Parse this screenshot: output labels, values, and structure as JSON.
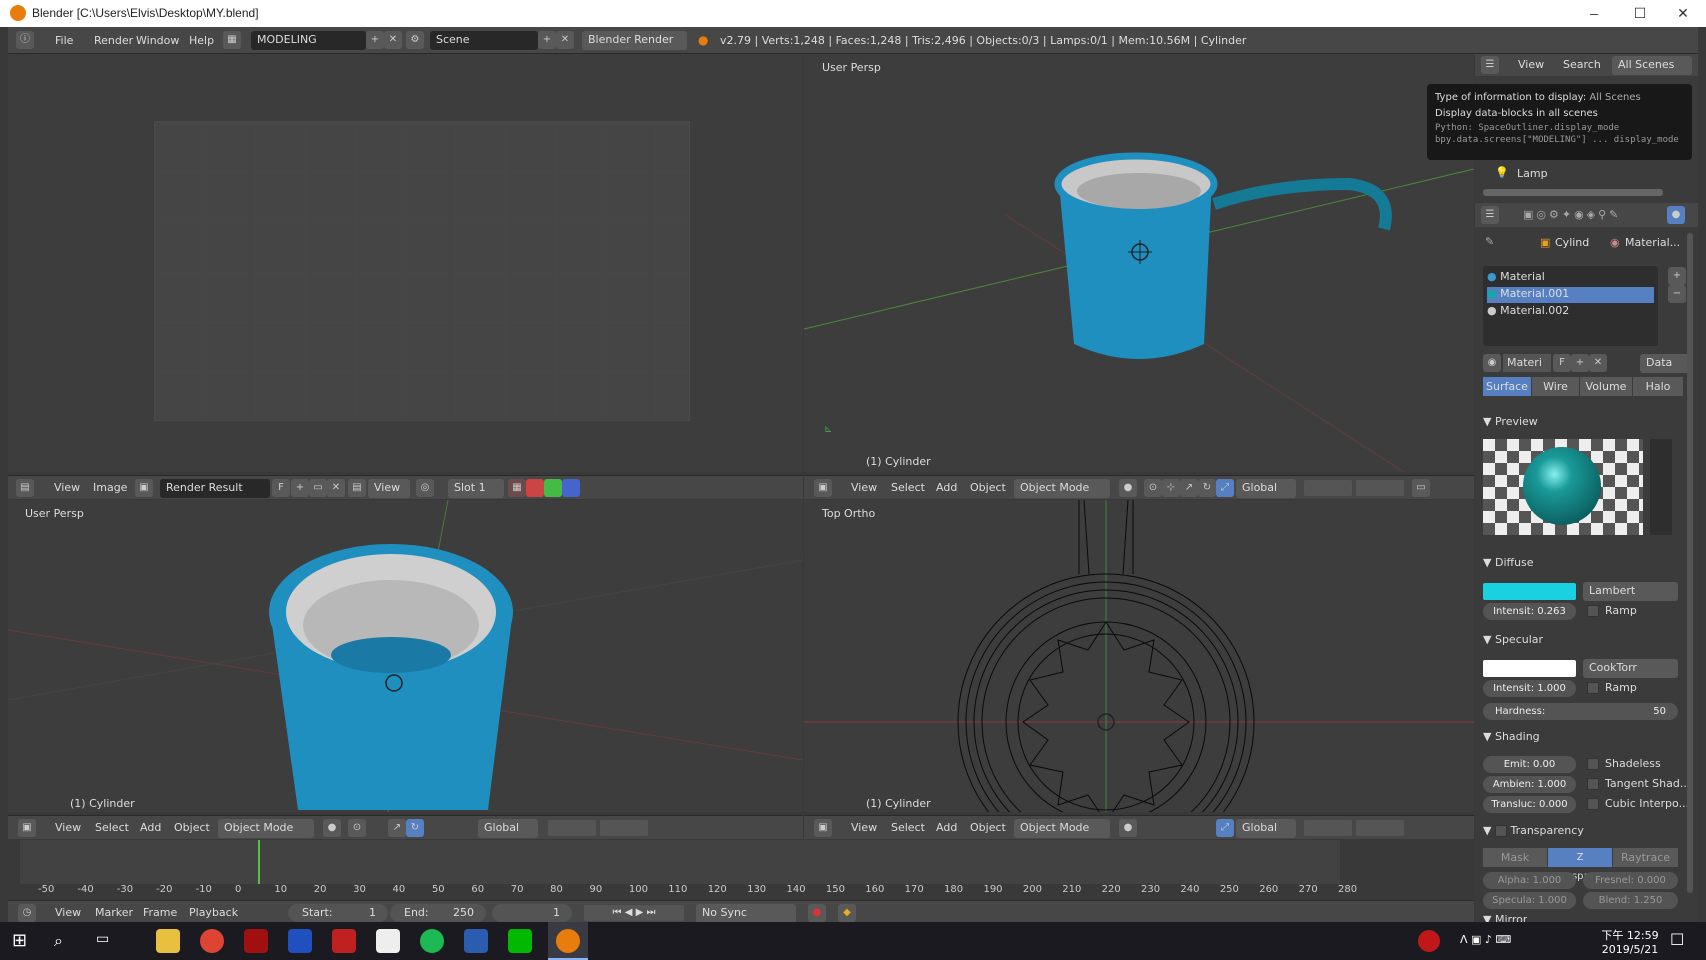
{
  "window": {
    "title": "Blender [C:\\Users\\Elvis\\Desktop\\MY.blend]",
    "minimize": "–",
    "maximize": "☐",
    "close": "✕"
  },
  "topbar": {
    "menus": [
      "File",
      "Render",
      "Window",
      "Help"
    ],
    "layout": "MODELING",
    "scene": "Scene",
    "engine": "Blender Render",
    "stats": "v2.79 | Verts:1,248 | Faces:1,248 | Tris:2,496 | Objects:0/3 | Lamps:0/1 | Mem:10.56M | Cylinder"
  },
  "uv_editor": {
    "menus": [
      "View",
      "Image"
    ],
    "image": "Render Result",
    "f": "F",
    "view": "View",
    "slot": "Slot 1"
  },
  "vp_tr": {
    "label": "User Persp",
    "object": "(1) Cylinder"
  },
  "vp_bl": {
    "label": "User Persp",
    "object": "(1) Cylinder"
  },
  "vp_br": {
    "label": "Top Ortho",
    "object": "(1) Cylinder"
  },
  "view3d_header": {
    "menus": [
      "View",
      "Select",
      "Add",
      "Object"
    ],
    "mode": "Object Mode",
    "orientation": "Global"
  },
  "outliner": {
    "menus": [
      "View",
      "Search"
    ],
    "display": "All Scenes",
    "lamp": "Lamp"
  },
  "tooltip": {
    "line1_label": "Type of information to display:",
    "line1_value": "All Scenes",
    "line2": "Display data-blocks in all scenes",
    "line3": "Python: SpaceOutliner.display_mode",
    "line4": "bpy.data.screens[\"MODELING\"] ... display_mode"
  },
  "properties": {
    "breadcrumb_obj": "Cylind",
    "breadcrumb_mat": "Material...",
    "materials": [
      "Material",
      "Material.001",
      "Material.002"
    ],
    "mat_name": "Materi",
    "f": "F",
    "data": "Data",
    "tabs": [
      "Surface",
      "Wire",
      "Volume",
      "Halo"
    ],
    "preview": "Preview",
    "diffuse": {
      "title": "Diffuse",
      "shader": "Lambert",
      "intensity": "Intensit: 0.263",
      "ramp": "Ramp",
      "color": "#19d1e0"
    },
    "specular": {
      "title": "Specular",
      "shader": "CookTorr",
      "intensity": "Intensit: 1.000",
      "ramp": "Ramp",
      "hardness_label": "Hardness:",
      "hardness": "50",
      "color": "#ffffff"
    },
    "shading": {
      "title": "Shading",
      "emit": "Emit:      0.00",
      "ambient": "Ambien: 1.000",
      "transl": "Transluc: 0.000",
      "shadeless": "Shadeless",
      "tangent": "Tangent Shad...",
      "cubic": "Cubic Interpo..."
    },
    "transparency": {
      "title": "Transparency",
      "tabs": [
        "Mask",
        "Z Transpare...",
        "Raytrace"
      ],
      "alpha": "Alpha:    1.000",
      "fresnel": "Fresnel: 0.000",
      "specu": "Specula: 1.000",
      "blend": "Blend:    1.250"
    },
    "mirror": "Mirror"
  },
  "timeline": {
    "ticks": [
      "-50",
      "-40",
      "-30",
      "-20",
      "-10",
      "0",
      "10",
      "20",
      "30",
      "40",
      "50",
      "60",
      "70",
      "80",
      "90",
      "100",
      "110",
      "120",
      "130",
      "140",
      "150",
      "160",
      "170",
      "180",
      "190",
      "200",
      "210",
      "220",
      "230",
      "240",
      "250",
      "260",
      "270",
      "280"
    ],
    "menus": [
      "View",
      "Marker",
      "Frame",
      "Playback"
    ],
    "start": "Start:",
    "start_val": "1",
    "end": "End:",
    "end_val": "250",
    "current": "1",
    "sync": "No Sync"
  },
  "taskbar": {
    "time": "下午 12:59",
    "date": "2019/5/21"
  },
  "colors": {
    "accent": "#5680c2",
    "mug": "#1f8fc0"
  }
}
